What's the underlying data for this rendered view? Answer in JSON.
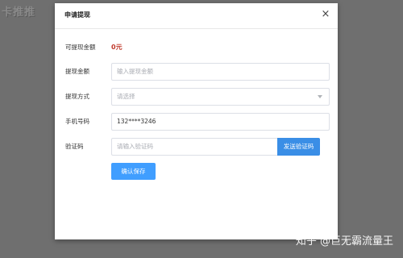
{
  "background": {
    "logo_text": "卡推推"
  },
  "dialog": {
    "title": "申请提现",
    "close_label": "×"
  },
  "form": {
    "withdrawable": {
      "label": "可提现金额",
      "value": "0元"
    },
    "amount": {
      "label": "提现金额",
      "placeholder": "输入提现金额",
      "value": ""
    },
    "method": {
      "label": "提现方式",
      "placeholder": "请选择",
      "selected": ""
    },
    "phone": {
      "label": "手机号码",
      "value": "132****3246"
    },
    "code": {
      "label": "验证码",
      "placeholder": "请输入验证码",
      "value": "",
      "send_button": "发送验证码"
    },
    "confirm_button": "确认保存"
  },
  "watermark": {
    "text": "知乎 @巨无霸流量王"
  },
  "colors": {
    "primary": "#409eff",
    "amount_red": "#c0392b",
    "overlay": "#6f6f6f"
  }
}
